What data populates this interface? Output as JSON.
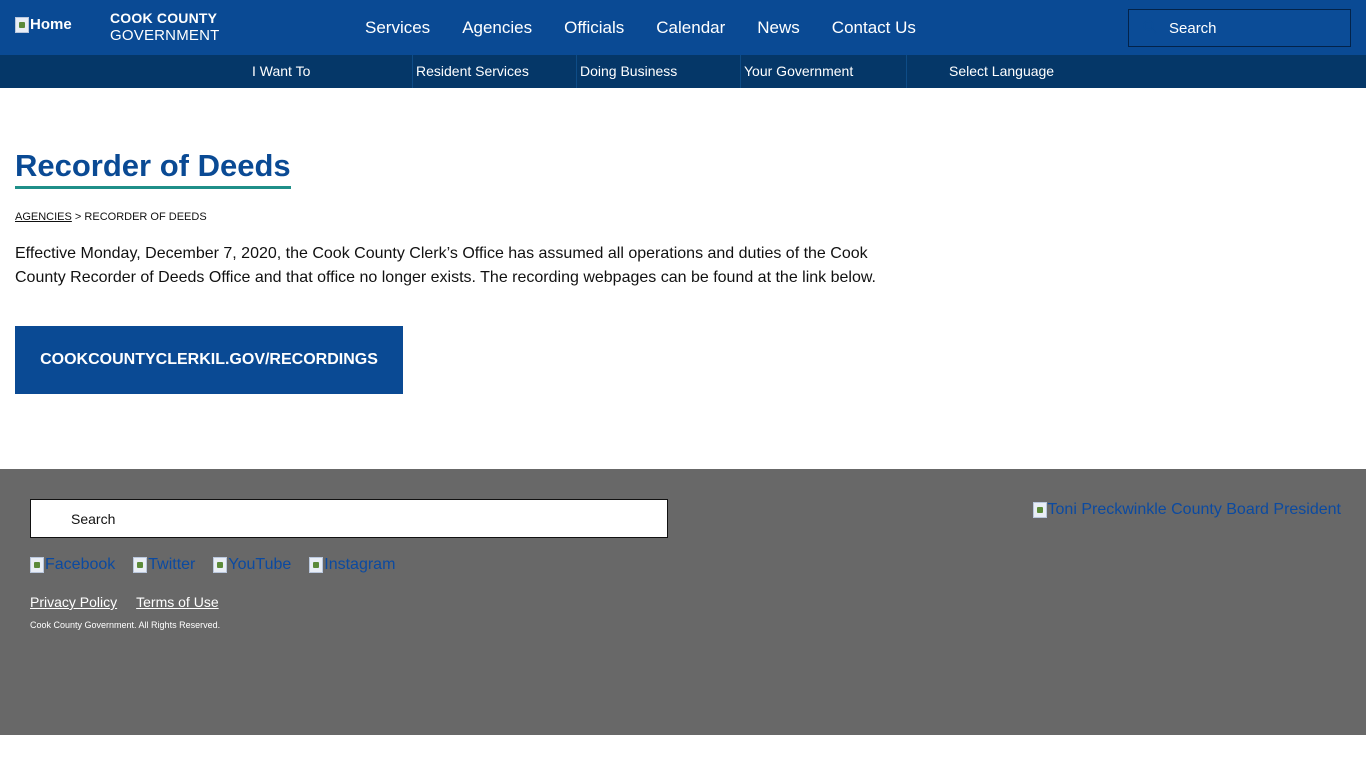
{
  "header": {
    "home_alt": "Home",
    "site_name_line1": "COOK COUNTY",
    "site_name_line2": "GOVERNMENT",
    "nav": [
      "Services",
      "Agencies",
      "Officials",
      "Calendar",
      "News",
      "Contact Us"
    ],
    "search_placeholder": "Search",
    "bg_color": "#0a4a94"
  },
  "subnav": {
    "items": [
      "I Want To",
      "Resident Services",
      "Doing Business",
      "Your Government",
      "Select Language"
    ],
    "bg_color": "#053768"
  },
  "main": {
    "title": "Recorder of Deeds",
    "breadcrumb": {
      "link": "AGENCIES",
      "separator": ">",
      "current": "RECORDER OF DEEDS"
    },
    "intro": "Effective Monday, December 7, 2020, the Cook County Clerk’s Office has assumed all operations and duties of the Cook County Recorder of Deeds Office and that office no longer exists. The recording webpages can be found at the link below.",
    "cta_label": "COOKCOUNTYCLERKIL.GOV/RECORDINGS",
    "accent_color": "#1f8f89"
  },
  "footer": {
    "search_placeholder": "Search",
    "social": [
      "Facebook",
      "Twitter",
      "YouTube",
      "Instagram"
    ],
    "links": [
      "Privacy Policy",
      "Terms of Use"
    ],
    "copyright": "Cook County Government. All Rights Reserved.",
    "president_alt": "Toni Preckwinkle County Board President",
    "bg_color": "#686868"
  }
}
